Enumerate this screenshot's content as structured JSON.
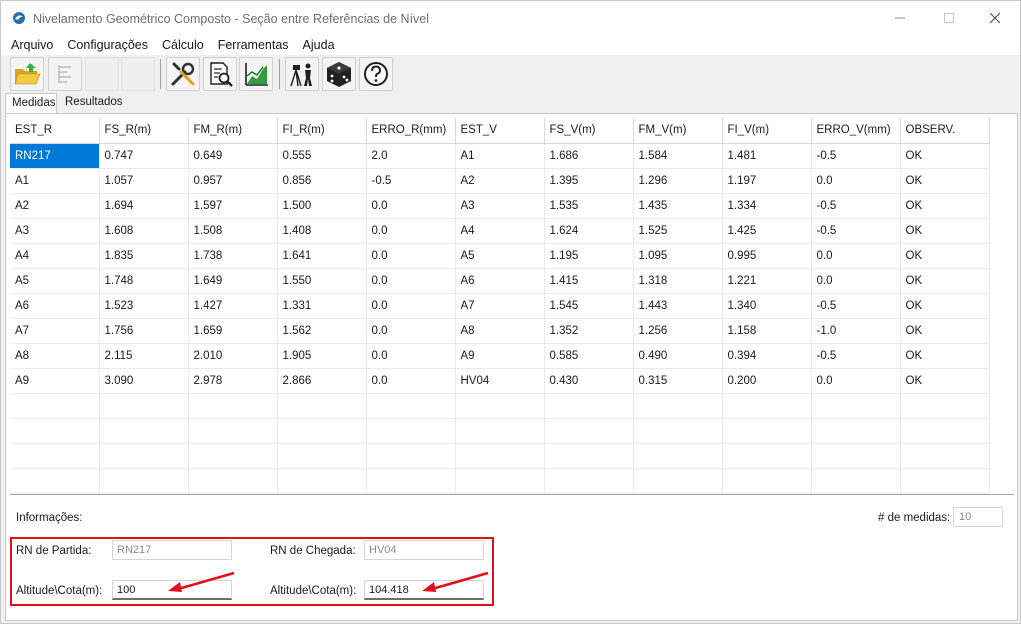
{
  "window": {
    "title": "Nivelamento Geométrico Composto - Seção entre Referências de Nível"
  },
  "menu": {
    "items": [
      "Arquivo",
      "Configurações",
      "Cálculo",
      "Ferramentas",
      "Ajuda"
    ]
  },
  "toolbar": {
    "icons": [
      "open-folder-icon",
      "align-icon",
      "",
      "",
      "tools-icon",
      "report-preview-icon",
      "chart-icon",
      "surveyor-level-icon",
      "dice-icon",
      "help-icon"
    ]
  },
  "tabs": [
    {
      "label": "Medidas",
      "active": true
    },
    {
      "label": "Resultados",
      "active": false
    }
  ],
  "grid": {
    "columns": [
      "EST_R",
      "FS_R(m)",
      "FM_R(m)",
      "FI_R(m)",
      "ERRO_R(mm)",
      "EST_V",
      "FS_V(m)",
      "FM_V(m)",
      "FI_V(m)",
      "ERRO_V(mm)",
      "OBSERV."
    ],
    "rows": [
      [
        "RN217",
        "0.747",
        "0.649",
        "0.555",
        "2.0",
        "A1",
        "1.686",
        "1.584",
        "1.481",
        "-0.5",
        "OK"
      ],
      [
        "A1",
        "1.057",
        "0.957",
        "0.856",
        "-0.5",
        "A2",
        "1.395",
        "1.296",
        "1.197",
        "0.0",
        "OK"
      ],
      [
        "A2",
        "1.694",
        "1.597",
        "1.500",
        "0.0",
        "A3",
        "1.535",
        "1.435",
        "1.334",
        "-0.5",
        "OK"
      ],
      [
        "A3",
        "1.608",
        "1.508",
        "1.408",
        "0.0",
        "A4",
        "1.624",
        "1.525",
        "1.425",
        "-0.5",
        "OK"
      ],
      [
        "A4",
        "1.835",
        "1.738",
        "1.641",
        "0.0",
        "A5",
        "1.195",
        "1.095",
        "0.995",
        "0.0",
        "OK"
      ],
      [
        "A5",
        "1.748",
        "1.649",
        "1.550",
        "0.0",
        "A6",
        "1.415",
        "1.318",
        "1.221",
        "0.0",
        "OK"
      ],
      [
        "A6",
        "1.523",
        "1.427",
        "1.331",
        "0.0",
        "A7",
        "1.545",
        "1.443",
        "1.340",
        "-0.5",
        "OK"
      ],
      [
        "A7",
        "1.756",
        "1.659",
        "1.562",
        "0.0",
        "A8",
        "1.352",
        "1.256",
        "1.158",
        "-1.0",
        "OK"
      ],
      [
        "A8",
        "2.115",
        "2.010",
        "1.905",
        "0.0",
        "A9",
        "0.585",
        "0.490",
        "0.394",
        "-0.5",
        "OK"
      ],
      [
        "A9",
        "3.090",
        "2.978",
        "2.866",
        "0.0",
        "HV04",
        "0.430",
        "0.315",
        "0.200",
        "0.0",
        "OK"
      ]
    ]
  },
  "info": {
    "label": "Informações:",
    "count_label": "# de medidas:",
    "count_value": "10",
    "rn_partida_label": "RN de Partida:",
    "rn_partida_value": "RN217",
    "rn_chegada_label": "RN de Chegada:",
    "rn_chegada_value": "HV04",
    "altitude_partida_label": "Altitude\\Cota(m):",
    "altitude_partida_value": "100",
    "altitude_chegada_label": "Altitude\\Cota(m):",
    "altitude_chegada_value": "104.418"
  },
  "colors": {
    "highlight_frame": "#e0101a",
    "selection": "#0078d7"
  }
}
